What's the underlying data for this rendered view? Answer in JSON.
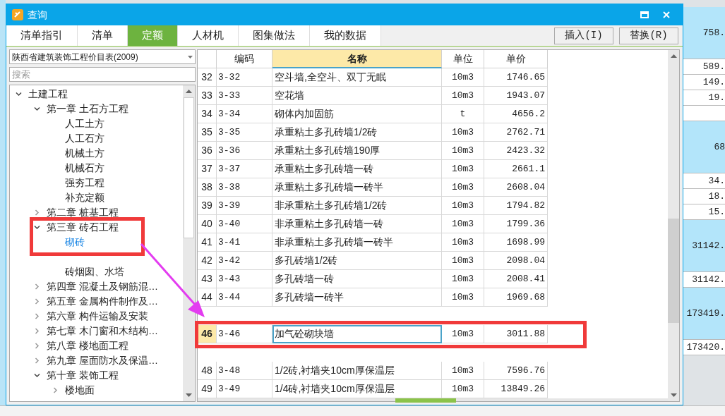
{
  "window": {
    "title": "查询"
  },
  "tabs": [
    {
      "label": "清单指引",
      "selected": false
    },
    {
      "label": "清单",
      "selected": false
    },
    {
      "label": "定额",
      "selected": true
    },
    {
      "label": "人材机",
      "selected": false
    },
    {
      "label": "图集做法",
      "selected": false
    },
    {
      "label": "我的数据",
      "selected": false
    }
  ],
  "buttons": [
    "插入(I)",
    "替换(R)"
  ],
  "library_select": {
    "value": "陕西省建筑装饰工程价目表(2009)"
  },
  "search": {
    "placeholder": "搜索"
  },
  "tree": [
    {
      "label": "土建工程",
      "expanded": true,
      "selected": false,
      "children": [
        {
          "label": "第一章  土石方工程",
          "expanded": true,
          "selected": false,
          "children": [
            {
              "label": "人工土方",
              "selected": false
            },
            {
              "label": "人工石方",
              "selected": false
            },
            {
              "label": "机械土方",
              "selected": false
            },
            {
              "label": "机械石方",
              "selected": false
            },
            {
              "label": "强夯工程",
              "selected": false
            },
            {
              "label": "补充定额",
              "selected": false
            }
          ]
        },
        {
          "label": "第二章  桩基工程",
          "expanded": false,
          "selected": false
        },
        {
          "label": "第三章  砖石工程",
          "expanded": true,
          "selected": false,
          "children": [
            {
              "label": "砌砖",
              "selected": true
            },
            {
              "selected": false
            },
            {
              "label": "砖烟囱、水塔",
              "selected": false
            }
          ]
        },
        {
          "label": "第四章  混凝土及钢筋混…",
          "expanded": false,
          "selected": false
        },
        {
          "label": "第五章  金属构件制作及…",
          "expanded": false,
          "selected": false
        },
        {
          "label": "第六章  构件运输及安装",
          "expanded": false,
          "selected": false
        },
        {
          "label": "第七章  木门窗和木结构…",
          "expanded": false,
          "selected": false
        },
        {
          "label": "第八章  楼地面工程",
          "expanded": false,
          "selected": false
        },
        {
          "label": "第九章  屋面防水及保温…",
          "expanded": false,
          "selected": false
        },
        {
          "label": "第十章  装饰工程",
          "expanded": true,
          "selected": false,
          "children": [
            {
              "label": "楼地面",
              "expanded": false,
              "selected": false
            }
          ]
        }
      ]
    }
  ],
  "table": {
    "columns": [
      "编码",
      "名称",
      "单位",
      "单价"
    ],
    "rows": [
      {
        "index": "32",
        "code": "3-32",
        "name": "空斗墙,全空斗、双丁无眠",
        "unit": "10m3",
        "price": "1746.65",
        "selected": false
      },
      {
        "index": "33",
        "code": "3-33",
        "name": "空花墙",
        "unit": "10m3",
        "price": "1943.07",
        "selected": false
      },
      {
        "index": "34",
        "code": "3-34",
        "name": "砌体内加固筋",
        "unit": "t",
        "price": "4656.2",
        "selected": false
      },
      {
        "index": "35",
        "code": "3-35",
        "name": "承重粘土多孔砖墙1/2砖",
        "unit": "10m3",
        "price": "2762.71",
        "selected": false
      },
      {
        "index": "36",
        "code": "3-36",
        "name": "承重粘土多孔砖墙190厚",
        "unit": "10m3",
        "price": "2423.32",
        "selected": false
      },
      {
        "index": "37",
        "code": "3-37",
        "name": "承重粘土多孔砖墙一砖",
        "unit": "10m3",
        "price": "2661.1",
        "selected": false
      },
      {
        "index": "38",
        "code": "3-38",
        "name": "承重粘土多孔砖墙一砖半",
        "unit": "10m3",
        "price": "2608.04",
        "selected": false
      },
      {
        "index": "39",
        "code": "3-39",
        "name": "非承重粘土多孔砖墙1/2砖",
        "unit": "10m3",
        "price": "1794.82",
        "selected": false
      },
      {
        "index": "40",
        "code": "3-40",
        "name": "非承重粘土多孔砖墙一砖",
        "unit": "10m3",
        "price": "1799.36",
        "selected": false
      },
      {
        "index": "41",
        "code": "3-41",
        "name": "非承重粘土多孔砖墙一砖半",
        "unit": "10m3",
        "price": "1698.99",
        "selected": false
      },
      {
        "index": "42",
        "code": "3-42",
        "name": "多孔砖墙1/2砖",
        "unit": "10m3",
        "price": "2098.04",
        "selected": false
      },
      {
        "index": "43",
        "code": "3-43",
        "name": "多孔砖墙一砖",
        "unit": "10m3",
        "price": "2008.41",
        "selected": false
      },
      {
        "index": "44",
        "code": "3-44",
        "name": "多孔砖墙一砖半",
        "unit": "10m3",
        "price": "1969.68",
        "selected": false
      },
      {
        "kind": "covered"
      },
      {
        "index": "46",
        "code": "3-46",
        "name": "加气砼砌块墙",
        "unit": "10m3",
        "price": "3011.88",
        "selected": true
      },
      {
        "kind": "covered"
      },
      {
        "index": "48",
        "code": "3-48",
        "name": "1/2砖,衬墙夹10cm厚保温层",
        "unit": "10m3",
        "price": "7596.76",
        "selected": false
      },
      {
        "index": "49",
        "code": "3-49",
        "name": "1/4砖,衬墙夹10cm厚保温层",
        "unit": "10m3",
        "price": "13849.26",
        "selected": false
      }
    ]
  },
  "background_column": [
    {
      "value": "758.",
      "highlighted": true
    },
    {
      "value": "589.",
      "highlighted": false
    },
    {
      "value": "149.",
      "highlighted": false
    },
    {
      "value": "19.",
      "highlighted": false
    },
    {
      "highlighted": false
    },
    {
      "value": "68",
      "highlighted": true
    },
    {
      "value": "34.",
      "highlighted": false
    },
    {
      "value": "18.",
      "highlighted": false
    },
    {
      "value": "15.",
      "highlighted": false
    },
    {
      "value": "31142.",
      "highlighted": true
    },
    {
      "value": "31142.",
      "highlighted": false
    },
    {
      "value": "173419.",
      "highlighted": true
    },
    {
      "value": "173420.",
      "highlighted": false
    }
  ]
}
